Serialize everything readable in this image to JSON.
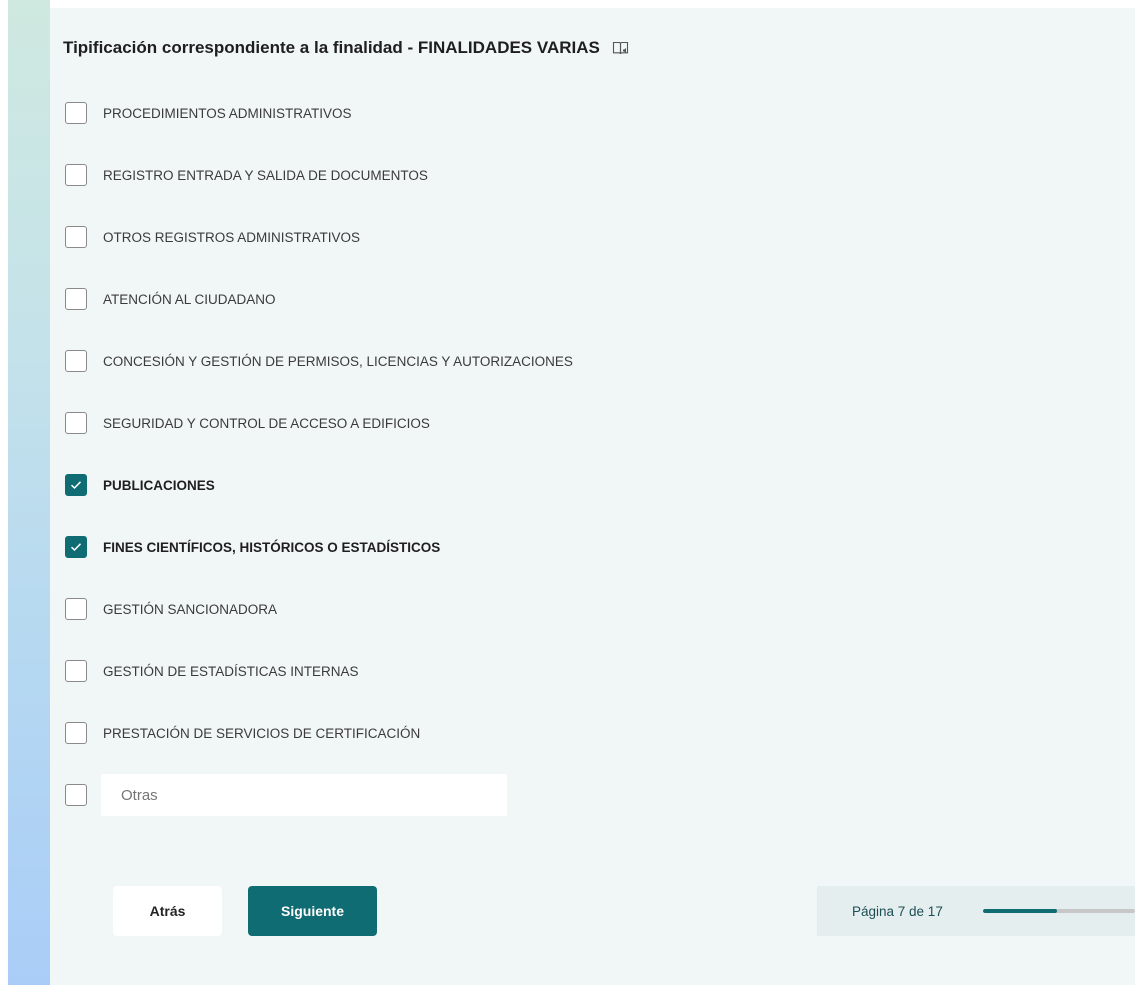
{
  "question": {
    "title": "Tipificación correspondiente a la finalidad - FINALIDADES VARIAS",
    "reader_icon": "immersive-reader-icon"
  },
  "options": [
    {
      "label": "PROCEDIMIENTOS ADMINISTRATIVOS",
      "checked": false
    },
    {
      "label": "REGISTRO ENTRADA Y SALIDA DE DOCUMENTOS",
      "checked": false
    },
    {
      "label": "OTROS REGISTROS ADMINISTRATIVOS",
      "checked": false
    },
    {
      "label": "ATENCIÓN AL CIUDADANO",
      "checked": false
    },
    {
      "label": "CONCESIÓN Y GESTIÓN DE PERMISOS, LICENCIAS Y AUTORIZACIONES",
      "checked": false
    },
    {
      "label": "SEGURIDAD Y CONTROL DE ACCESO A EDIFICIOS",
      "checked": false
    },
    {
      "label": "PUBLICACIONES",
      "checked": true
    },
    {
      "label": "FINES CIENTÍFICOS, HISTÓRICOS O ESTADÍSTICOS",
      "checked": true
    },
    {
      "label": "GESTIÓN SANCIONADORA",
      "checked": false
    },
    {
      "label": "GESTIÓN DE ESTADÍSTICAS INTERNAS",
      "checked": false
    },
    {
      "label": "PRESTACIÓN DE SERVICIOS DE CERTIFICACIÓN",
      "checked": false
    }
  ],
  "other_option": {
    "checked": false,
    "placeholder": "Otras"
  },
  "nav": {
    "back_label": "Atrás",
    "next_label": "Siguiente"
  },
  "progress": {
    "text": "Página 7 de 17",
    "current": 7,
    "total": 17
  },
  "colors": {
    "accent": "#0f6c73",
    "panel": "#f1f6f7"
  }
}
